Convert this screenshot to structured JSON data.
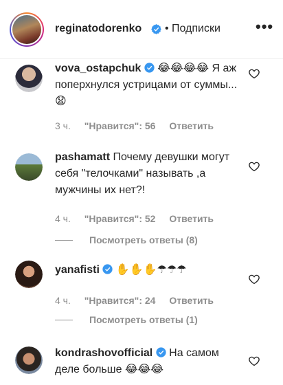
{
  "header": {
    "username": "reginatodorenko",
    "separator": "•",
    "follow_label": "Подписки",
    "more_label": "•••"
  },
  "colors": {
    "verified": "#3897f0",
    "muted": "#8e8e8e",
    "text": "#262626"
  },
  "comments": [
    {
      "username": "vova_ostapchuk",
      "verified": true,
      "text_line1": "😂😂😂😂 Я аж",
      "text_rest": "поперхнулся устрицами от суммы... 😧",
      "time": "3 ч.",
      "likes": "\"Нравится\": 56",
      "reply": "Ответить"
    },
    {
      "username": "pashamatt",
      "verified": false,
      "text_line1": "Почему девушки",
      "text_rest": "могут себя \"телочками\" называть ,а мужчины их нет?!",
      "time": "4 ч.",
      "likes": "\"Нравится\": 52",
      "reply": "Ответить",
      "view_replies": "Посмотреть ответы (8)"
    },
    {
      "username": "yanafisti",
      "verified": true,
      "text_line1": "✋✋✋☂☂☂",
      "time": "4 ч.",
      "likes": "\"Нравится\": 24",
      "reply": "Ответить",
      "view_replies": "Посмотреть ответы (1)"
    },
    {
      "username": "kondrashovofficial",
      "verified": true,
      "text_line1": "На самом",
      "text_rest": "деле больше 😂😂😂"
    }
  ],
  "icons": {
    "verified": "verified-badge-icon",
    "heart": "heart-outline-icon",
    "more": "more-horizontal-icon"
  }
}
